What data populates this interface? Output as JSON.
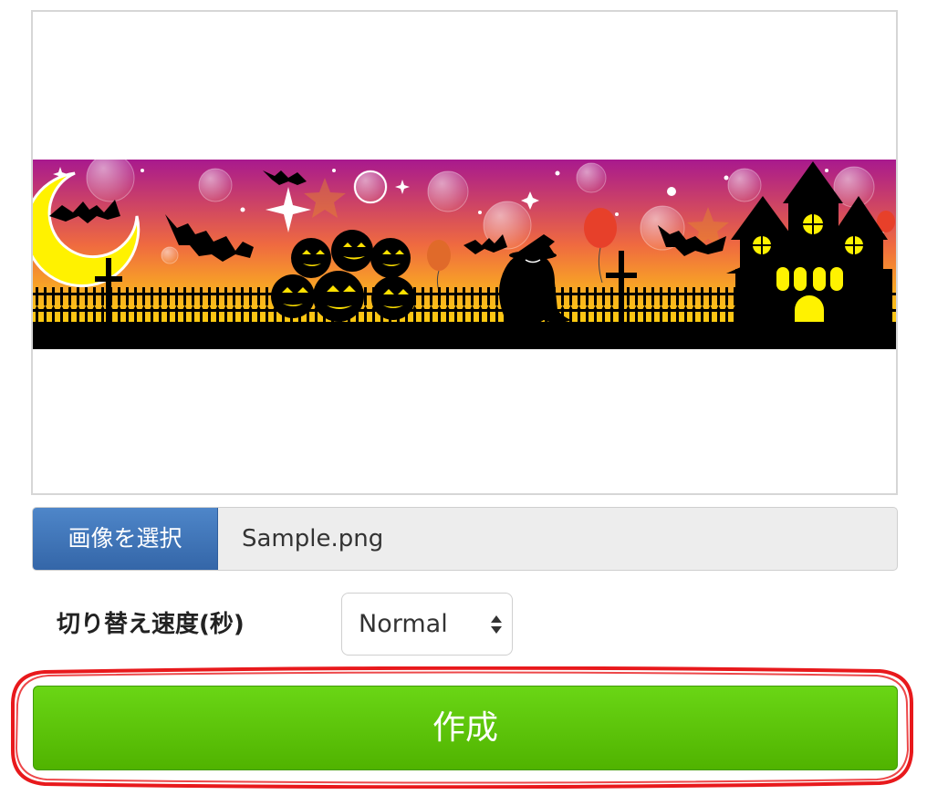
{
  "preview": {
    "image_name": "halloween-banner-image"
  },
  "file_input": {
    "button_label": "画像を選択",
    "file_name": "Sample.png"
  },
  "speed": {
    "label": "切り替え速度(秒)",
    "selected": "Normal"
  },
  "create_button": {
    "label": "作成"
  },
  "colors": {
    "file_button": "#3f74b8",
    "create_button": "#5cc40a",
    "highlight_outline": "#e8191c",
    "banner_sky_top": "#a8198e",
    "banner_sky_bottom": "#ffe100"
  }
}
